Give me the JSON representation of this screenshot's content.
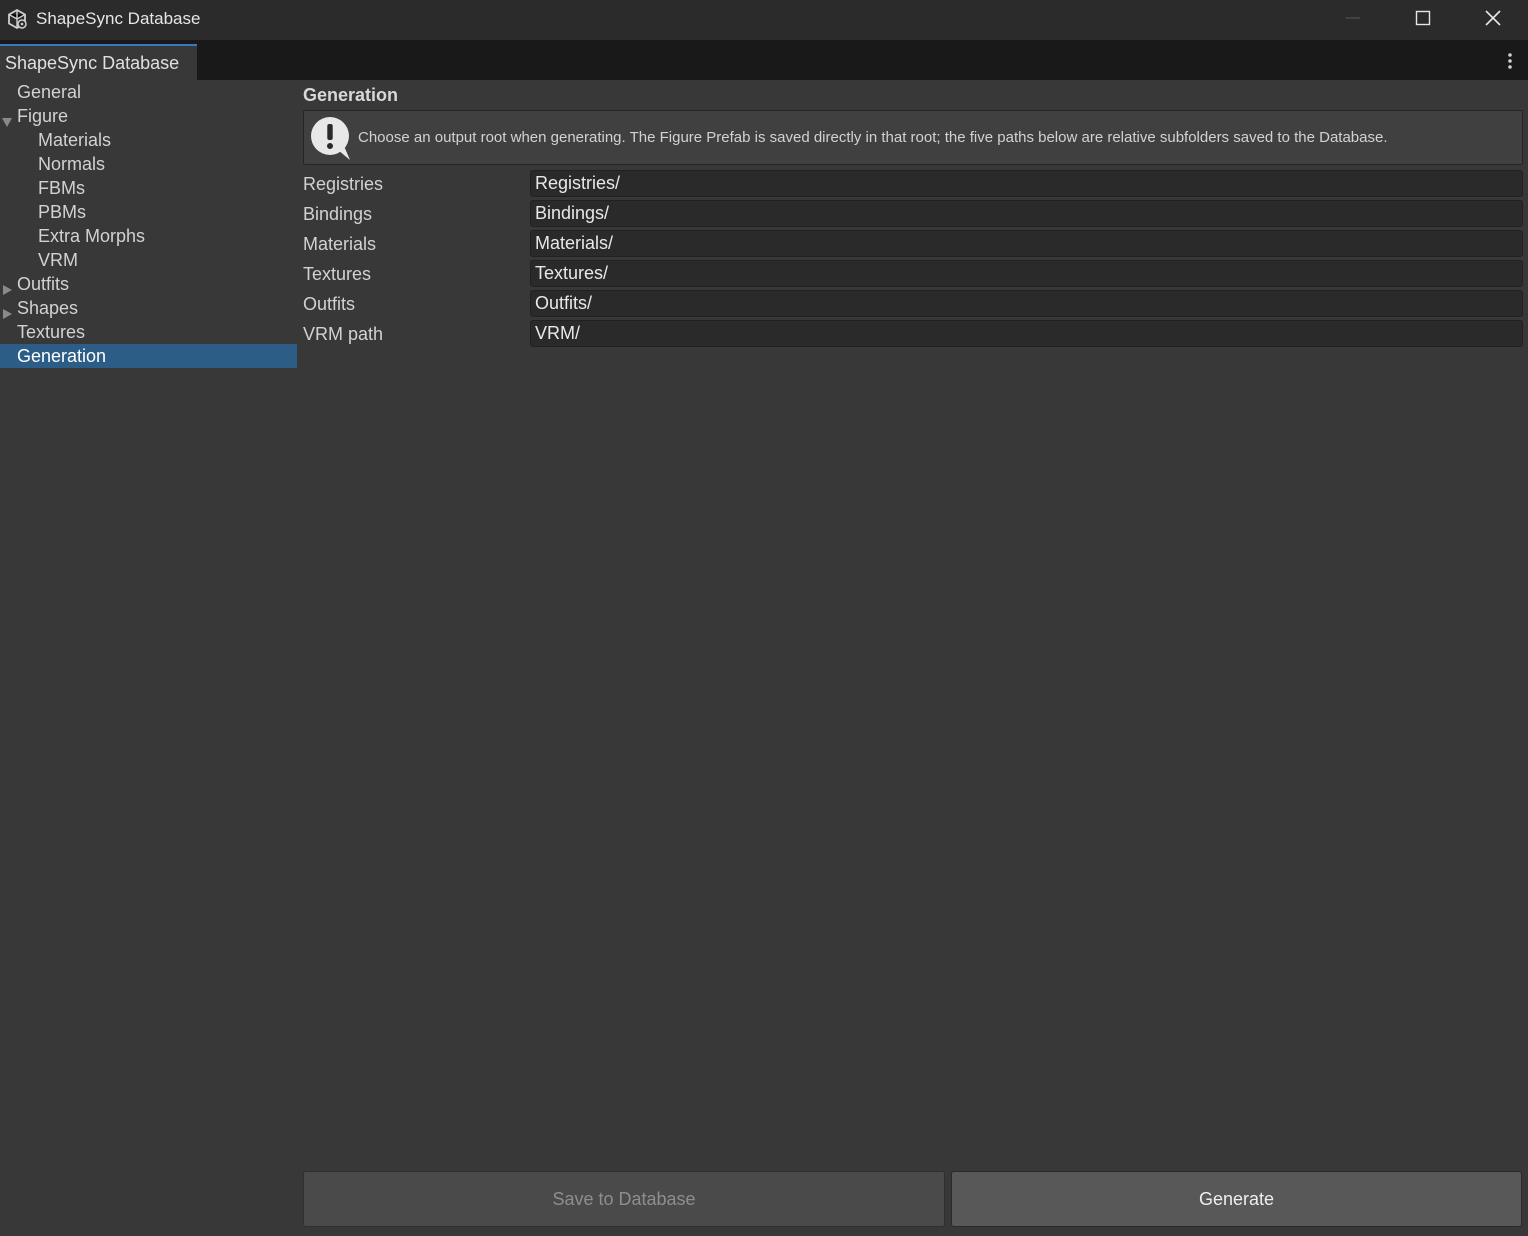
{
  "window": {
    "title": "ShapeSync Database"
  },
  "tab": {
    "label": "ShapeSync Database"
  },
  "sidebar": {
    "items": [
      {
        "label": "General",
        "indent": 0,
        "arrow": "none",
        "selected": false
      },
      {
        "label": "Figure",
        "indent": 0,
        "arrow": "expanded",
        "selected": false
      },
      {
        "label": "Materials",
        "indent": 1,
        "arrow": "none",
        "selected": false
      },
      {
        "label": "Normals",
        "indent": 1,
        "arrow": "none",
        "selected": false
      },
      {
        "label": "FBMs",
        "indent": 1,
        "arrow": "none",
        "selected": false
      },
      {
        "label": "PBMs",
        "indent": 1,
        "arrow": "none",
        "selected": false
      },
      {
        "label": "Extra Morphs",
        "indent": 1,
        "arrow": "none",
        "selected": false
      },
      {
        "label": "VRM",
        "indent": 1,
        "arrow": "none",
        "selected": false
      },
      {
        "label": "Outfits",
        "indent": 0,
        "arrow": "collapsed",
        "selected": false
      },
      {
        "label": "Shapes",
        "indent": 0,
        "arrow": "collapsed",
        "selected": false
      },
      {
        "label": "Textures",
        "indent": 0,
        "arrow": "none",
        "selected": false
      },
      {
        "label": "Generation",
        "indent": 0,
        "arrow": "none",
        "selected": true
      }
    ]
  },
  "main": {
    "section_title": "Generation",
    "help_text": "Choose an output root when generating. The Figure Prefab is saved directly in that root; the five paths below are relative subfolders saved to the Database.",
    "fields": [
      {
        "label": "Registries",
        "value": "Registries/"
      },
      {
        "label": "Bindings",
        "value": "Bindings/"
      },
      {
        "label": "Materials",
        "value": "Materials/"
      },
      {
        "label": "Textures",
        "value": "Textures/"
      },
      {
        "label": "Outfits",
        "value": "Outfits/"
      },
      {
        "label": "VRM path",
        "value": "VRM/"
      }
    ],
    "save_label": "Save to Database",
    "generate_label": "Generate"
  },
  "colors": {
    "selection": "#2c5d87",
    "tab_accent": "#3a79bb",
    "background": "#383838"
  }
}
